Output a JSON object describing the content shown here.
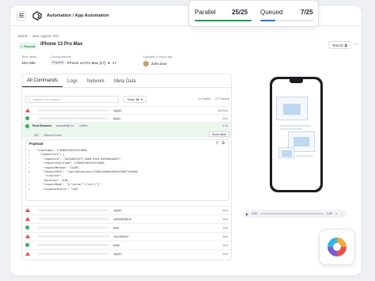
{
  "header": {
    "app_title": "Automation / App Automation"
  },
  "status_card": {
    "parallel_label": "Parallel",
    "parallel_value": "25/25",
    "queued_label": "Queued",
    "queued_value": "7/25",
    "colors": {
      "parallel": "#1e9f4a",
      "queued": "#2f74d8"
    }
  },
  "breadcrumb": {
    "root": "Builds",
    "current": "Java Appium iOS"
  },
  "test": {
    "status": "Passed",
    "device": "iPhone 13 Pro Max",
    "test_id_label": "Test ID"
  },
  "meta": {
    "time_taken_label": "Time taken",
    "time_taken": "16m 59s",
    "config_label": "Configurations",
    "config_type": "Physical",
    "config_device": "iPhone 13 Pro Max [17]",
    "config_os": "17",
    "updated_label": "Updated 9 hours ago",
    "user": "John Doe"
  },
  "log_panel": {
    "tabs": [
      "All Commands",
      "Logs",
      "Network",
      "Meta Data"
    ],
    "search_placeholder": "Search Commands",
    "view_label": "View: All",
    "failed_count": "24 Failed",
    "passed_count": "27 Passed",
    "rows_top": [
      {
        "status": "fail",
        "tag": "appId",
        "duration": "4007ms"
      },
      {
        "status": "ok",
        "tag": "appId",
        "duration": "1ms"
      }
    ],
    "highlight": {
      "title": "Find Element",
      "tag1": "accessibility id",
      "tag2": "cutBox",
      "duration": "0.1s",
      "chips": [
        "iOS",
        "Element found"
      ],
      "show_label": "Show table"
    },
    "rows_bottom": [
      {
        "status": "fail",
        "tag": "appId",
        "duration": "1ms"
      },
      {
        "status": "fail",
        "tag": "accessibility id",
        "duration": "1ms"
      },
      {
        "status": "ok",
        "tag": "keys",
        "duration": "1ms"
      },
      {
        "status": "fail",
        "tag": "css selector",
        "duration": "1ms"
      },
      {
        "status": "ok",
        "tag": "script",
        "duration": "1ms"
      },
      {
        "status": "fail",
        "tag": "appId",
        "duration": "1ms"
      }
    ]
  },
  "payload": {
    "title": "Payload",
    "lines": [
      "\"timestamp\": 1705691945315513000,",
      "  \"requestInfo\": {",
      "    \"requestId\": \"5b74d82fb7f7-4b69-8fe9-5d9f0a54b957\",",
      "    \"requestStartTime\": 1705691945315513000,",
      "    \"requestMethod\": \"GLOB\",",
      "    \"requestPath\": \"/wd/hub/session/1f3b8c2d9a5e4b0fd7a6b71c3e9d/",
      "      find/text\",",
      "    \"duration\": 2105,",
      "    \"requestBody\": \"{\\\"value\\\":\\\"null\\\"}\",",
      "    \"responseStatus\": \"404\""
    ]
  },
  "player": {
    "time_start": "0:00",
    "time_end": "2:25"
  }
}
